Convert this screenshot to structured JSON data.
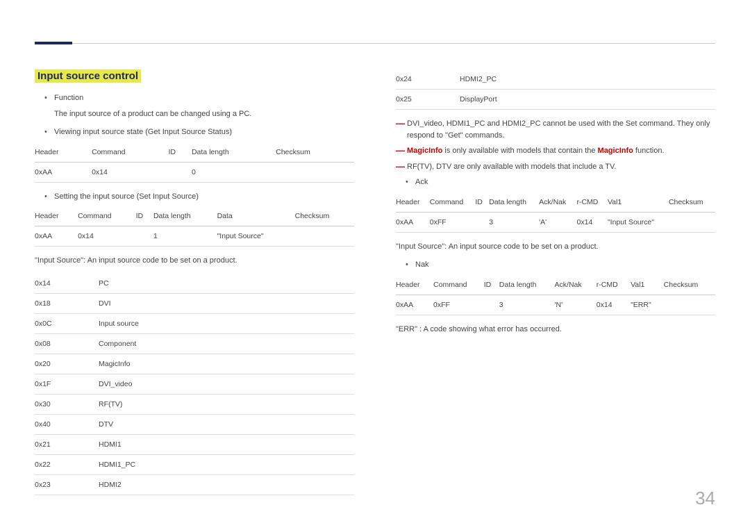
{
  "page_number": "34",
  "section_title": "Input source control",
  "left": {
    "b_function": "Function",
    "function_desc": "The input source of a product can be changed using a PC.",
    "b_viewing": "Viewing input source state (Get Input Source Status)",
    "get_table": {
      "headers": [
        "Header",
        "Command",
        "ID",
        "Data length",
        "Checksum"
      ],
      "row": [
        "0xAA",
        "0x14",
        "",
        "0",
        ""
      ]
    },
    "b_setting": "Setting the input source (Set Input Source)",
    "set_table": {
      "headers": [
        "Header",
        "Command",
        "ID",
        "Data length",
        "Data",
        "Checksum"
      ],
      "row": [
        "0xAA",
        "0x14",
        "",
        "1",
        "\"Input Source\"",
        ""
      ]
    },
    "src_desc": "\"Input Source\": An input source code to be set on a product.",
    "src_table": [
      [
        "0x14",
        "PC"
      ],
      [
        "0x18",
        "DVI"
      ],
      [
        "0x0C",
        "Input source"
      ],
      [
        "0x08",
        "Component"
      ],
      [
        "0x20",
        "MagicInfo"
      ],
      [
        "0x1F",
        "DVI_video"
      ],
      [
        "0x30",
        "RF(TV)"
      ],
      [
        "0x40",
        "DTV"
      ],
      [
        "0x21",
        "HDMI1"
      ],
      [
        "0x22",
        "HDMI1_PC"
      ],
      [
        "0x23",
        "HDMI2"
      ]
    ]
  },
  "right": {
    "src_table_cont": [
      [
        "0x24",
        "HDMI2_PC"
      ],
      [
        "0x25",
        "DisplayPort"
      ]
    ],
    "dash1": "DVI_video, HDMI1_PC and HDMI2_PC cannot be used with the Set command. They only respond to \"Get\" commands.",
    "dash2_pre": "MagicInfo",
    "dash2_mid": " is only available with models that contain the ",
    "dash2_post": "MagicInfo",
    "dash2_end": " function.",
    "dash3": "RF(TV), DTV are only available with models that include a TV.",
    "b_ack": "Ack",
    "ack_table": {
      "headers": [
        "Header",
        "Command",
        "ID",
        "Data length",
        "Ack/Nak",
        "r-CMD",
        "Val1",
        "Checksum"
      ],
      "row": [
        "0xAA",
        "0xFF",
        "",
        "3",
        "'A'",
        "0x14",
        "\"Input Source\"",
        ""
      ]
    },
    "ack_desc": "\"Input Source\": An input source code to be set on a product.",
    "b_nak": "Nak",
    "nak_table": {
      "headers": [
        "Header",
        "Command",
        "ID",
        "Data length",
        "Ack/Nak",
        "r-CMD",
        "Val1",
        "Checksum"
      ],
      "row": [
        "0xAA",
        "0xFF",
        "",
        "3",
        "'N'",
        "0x14",
        "\"ERR\"",
        ""
      ]
    },
    "err_desc": "\"ERR\" : A code showing what error has occurred."
  }
}
